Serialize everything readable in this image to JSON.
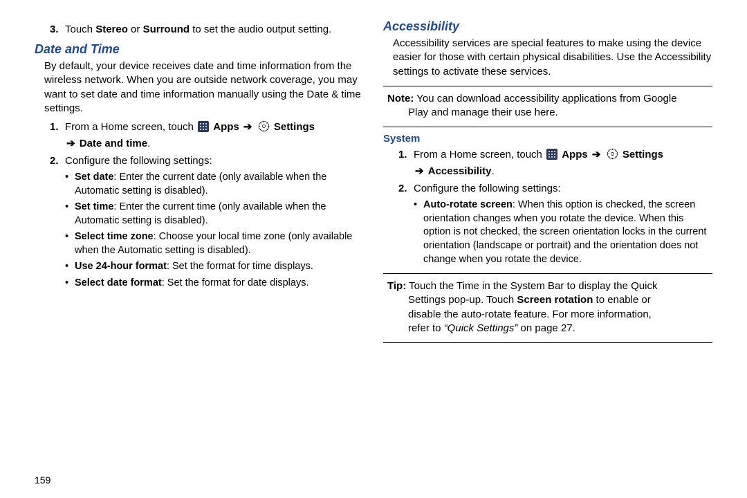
{
  "left": {
    "step3": {
      "num": "3.",
      "pre": "Touch ",
      "b1": "Stereo",
      "mid": " or ",
      "b2": "Surround",
      "post": " to set the audio output setting."
    },
    "heading": "Date and Time",
    "intro": "By default, your device receives date and time information from the wireless network. When you are outside network coverage, you may want to set date and time information manually using the Date & time settings.",
    "step1": {
      "num": "1.",
      "pre": "From a Home screen, touch ",
      "apps": "Apps",
      "arrow1": "➔",
      "settings": "Settings",
      "arrow2": "➔",
      "tail": "Date and time",
      "dot": "."
    },
    "step2": {
      "num": "2.",
      "text": "Configure the following settings:"
    },
    "bullets": [
      {
        "b": "Set date",
        "t": ": Enter the current date (only available when the Automatic setting is disabled)."
      },
      {
        "b": "Set time",
        "t": ": Enter the current time (only available when the Automatic setting is disabled)."
      },
      {
        "b": "Select time zone",
        "t": ": Choose your local time zone (only available when the Automatic setting is disabled)."
      },
      {
        "b": "Use 24-hour format",
        "t": ": Set the format for time displays."
      },
      {
        "b": "Select date format",
        "t": ": Set the format for date displays."
      }
    ],
    "pagenum": "159"
  },
  "right": {
    "heading": "Accessibility",
    "intro": "Accessibility services are special features to make using the device easier for those with certain physical disabilities. Use the Accessibility settings to activate these services.",
    "note": {
      "label": "Note:",
      "line1": " You can download accessibility applications from Google",
      "line2": "Play and manage their use here."
    },
    "subhead": "System",
    "step1": {
      "num": "1.",
      "pre": "From a Home screen, touch ",
      "apps": "Apps",
      "arrow1": "➔",
      "settings": "Settings",
      "arrow2": "➔",
      "tail": "Accessibility",
      "dot": "."
    },
    "step2": {
      "num": "2.",
      "text": "Configure the following settings:"
    },
    "bullet": {
      "b": "Auto-rotate screen",
      "t": ": When this option is checked, the screen orientation changes when you rotate the device. When this option is not checked, the screen orientation locks in the current orientation (landscape or portrait) and the orientation does not change when you rotate the device."
    },
    "tip": {
      "label": "Tip:",
      "l1a": " Touch the Time in the System Bar to display the Quick",
      "l2a": "Settings pop-up. Touch ",
      "l2b": "Screen rotation",
      "l2c": " to enable or",
      "l3": "disable the auto-rotate feature. For more information,",
      "l4a": "refer to ",
      "l4q": "“Quick Settings”",
      "l4b": " on page 27."
    }
  }
}
